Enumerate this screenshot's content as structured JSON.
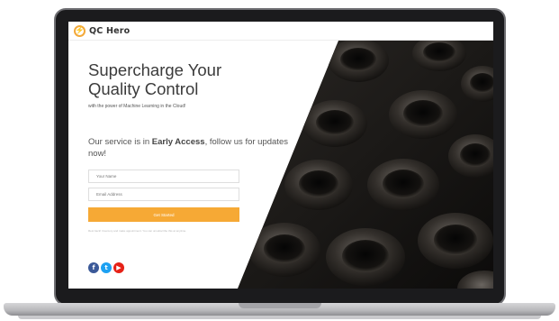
{
  "brand": {
    "logo_glyph": "⚡",
    "name": "QC Hero",
    "accent_color": "#f3a93a"
  },
  "hero": {
    "headline_line1": "Supercharge Your",
    "headline_line2": "Quality Control",
    "subline": "with the power of Machine Learning in the Cloud!",
    "service_prefix": "Our service is in ",
    "service_bold": "Early Access",
    "service_suffix": ", follow us for updates now!"
  },
  "form": {
    "name_placeholder": "Your Name",
    "email_placeholder": "Email Address",
    "submit_label": "Get Started",
    "submit_color": "#f6a935",
    "fineprint": "Rest back! Inventory and make appointment. You can unsubscribe this at anytime."
  },
  "social": {
    "facebook_glyph": "f",
    "twitter_glyph": "t",
    "youtube_glyph": "▶",
    "facebook_color": "#3b5998",
    "twitter_color": "#1da1f2",
    "youtube_color": "#e62117"
  }
}
